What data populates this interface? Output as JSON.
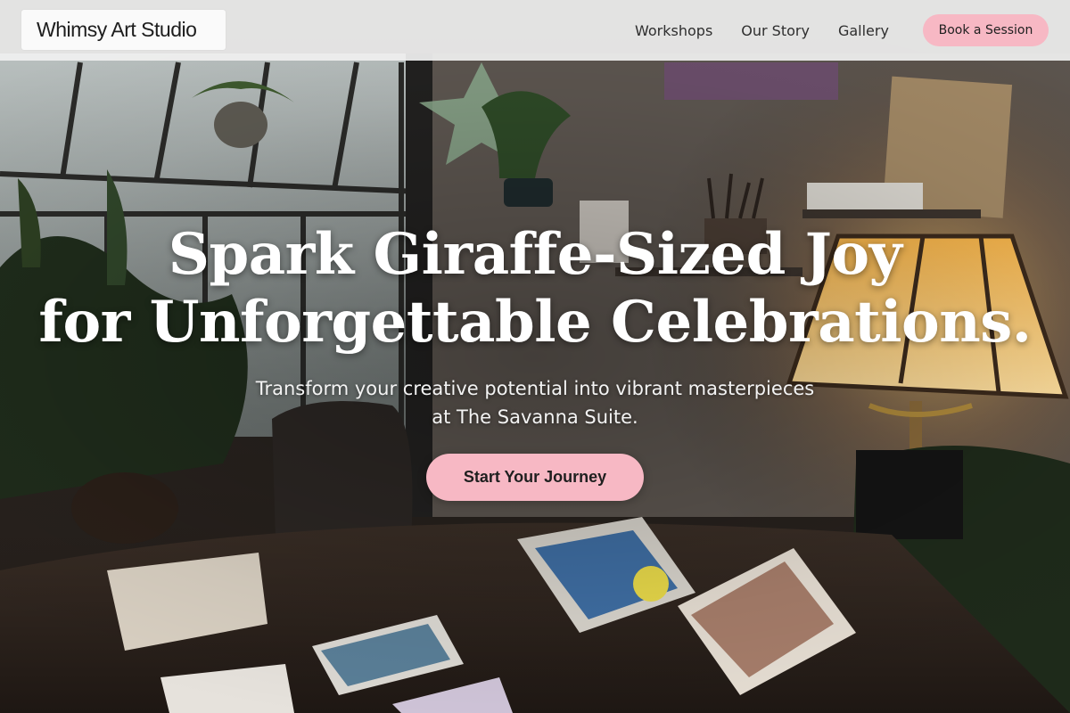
{
  "navbar": {
    "brand": "Whimsy Art Studio",
    "links": [
      {
        "label": "Workshops"
      },
      {
        "label": "Our Story"
      },
      {
        "label": "Gallery"
      }
    ],
    "cta_label": "Book a Session"
  },
  "hero": {
    "title_line1": "Spark Giraffe-Sized Joy",
    "title_line2": "for Unforgettable Celebrations.",
    "subtitle_line1": "Transform your creative potential into vibrant masterpieces",
    "subtitle_line2": "at The Savanna Suite.",
    "cta_label": "Start Your Journey"
  },
  "colors": {
    "accent_pink": "#f7b8c4",
    "navbar_bg": "#f0f0f0",
    "hero_text": "#ffffff"
  }
}
